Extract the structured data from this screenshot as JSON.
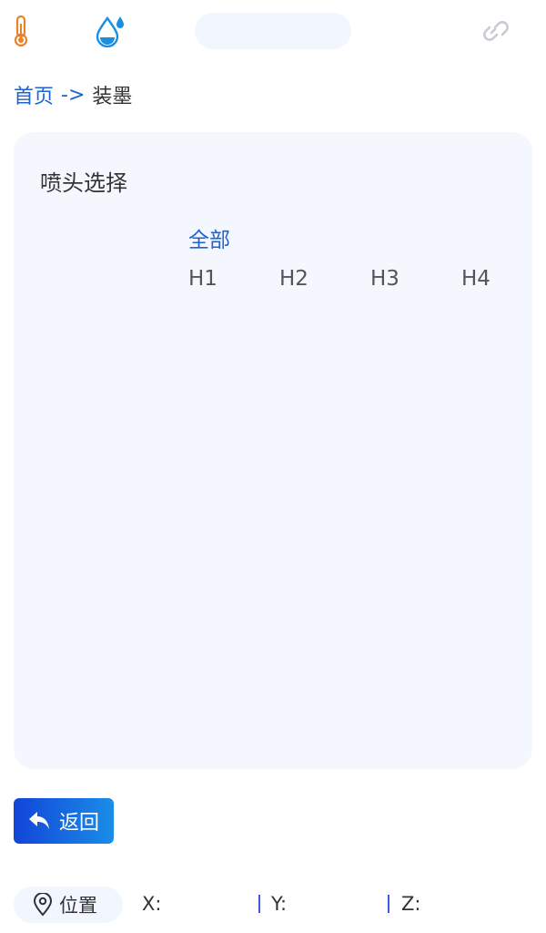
{
  "header": {
    "icons": {
      "temperature": "thermometer-icon",
      "ink": "ink-drop-icon",
      "connection": "link-icon"
    },
    "status_text": ""
  },
  "breadcrumb": {
    "home": "首页",
    "separator": "->",
    "current": "装墨"
  },
  "nozzle_select": {
    "title": "喷头选择",
    "all_label": "全部",
    "heads": [
      "H1",
      "H2",
      "H3",
      "H4"
    ]
  },
  "actions": {
    "back_label": "返回"
  },
  "position": {
    "label": "位置",
    "x_label": "X:",
    "x_value": "",
    "y_label": "Y:",
    "y_value": "",
    "z_label": "Z:",
    "z_value": ""
  },
  "colors": {
    "accent": "#1e63d1",
    "card_bg": "#f4f7fe",
    "thermometer": "#e8832a",
    "drop": "#1a8fe0",
    "link_disabled": "#c8ccd2"
  }
}
